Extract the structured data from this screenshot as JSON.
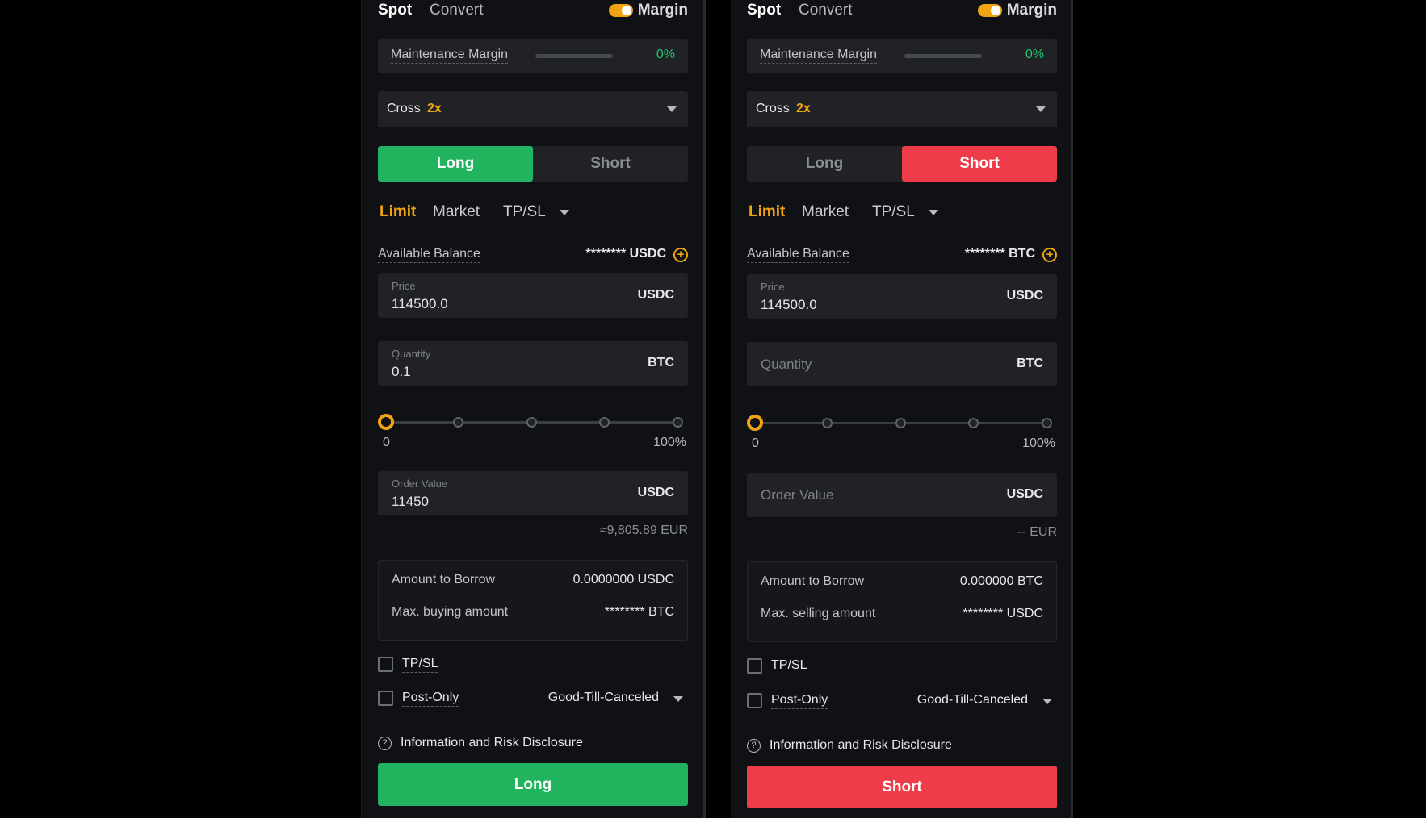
{
  "colors": {
    "accent": "#f0a413",
    "long": "#22b35e",
    "short": "#ee3d49",
    "positive": "#25c26e"
  },
  "left": {
    "nav": {
      "spot": "Spot",
      "convert": "Convert",
      "margin": "Margin"
    },
    "maintenance": {
      "label": "Maintenance Margin",
      "value": "0%"
    },
    "cross": {
      "label": "Cross",
      "leverage": "2x"
    },
    "side_tabs": {
      "long": "Long",
      "short": "Short",
      "active": "long"
    },
    "order_tabs": {
      "limit": "Limit",
      "market": "Market",
      "tpsl": "TP/SL"
    },
    "available": {
      "label": "Available Balance",
      "value": "******** USDC"
    },
    "price": {
      "label": "Price",
      "value": "114500.0",
      "unit": "USDC"
    },
    "quantity": {
      "label": "Quantity",
      "value": "0.1",
      "unit": "BTC"
    },
    "slider": {
      "min": "0",
      "max": "100%",
      "value_percent": 0
    },
    "order_value": {
      "label": "Order Value",
      "value": "11450",
      "unit": "USDC"
    },
    "eur": "≈9,805.89 EUR",
    "borrow": {
      "amount_label": "Amount to Borrow",
      "amount_value": "0.0000000 USDC",
      "max_label": "Max. buying amount",
      "max_value": "******** BTC"
    },
    "tpsl_check": "TP/SL",
    "post_only": "Post-Only",
    "tif": "Good-Till-Canceled",
    "disclosure": "Information and Risk Disclosure",
    "submit": "Long"
  },
  "right": {
    "nav": {
      "spot": "Spot",
      "convert": "Convert",
      "margin": "Margin"
    },
    "maintenance": {
      "label": "Maintenance Margin",
      "value": "0%"
    },
    "cross": {
      "label": "Cross",
      "leverage": "2x"
    },
    "side_tabs": {
      "long": "Long",
      "short": "Short",
      "active": "short"
    },
    "order_tabs": {
      "limit": "Limit",
      "market": "Market",
      "tpsl": "TP/SL"
    },
    "available": {
      "label": "Available Balance",
      "value": "******** BTC"
    },
    "price": {
      "label": "Price",
      "value": "114500.0",
      "unit": "USDC"
    },
    "quantity": {
      "placeholder": "Quantity",
      "unit": "BTC"
    },
    "slider": {
      "min": "0",
      "max": "100%",
      "value_percent": 0
    },
    "order_value": {
      "placeholder": "Order Value",
      "unit": "USDC"
    },
    "eur": "-- EUR",
    "borrow": {
      "amount_label": "Amount to Borrow",
      "amount_value": "0.000000 BTC",
      "max_label": "Max. selling amount",
      "max_value": "******** USDC"
    },
    "tpsl_check": "TP/SL",
    "post_only": "Post-Only",
    "tif": "Good-Till-Canceled",
    "disclosure": "Information and Risk Disclosure",
    "submit": "Short"
  }
}
